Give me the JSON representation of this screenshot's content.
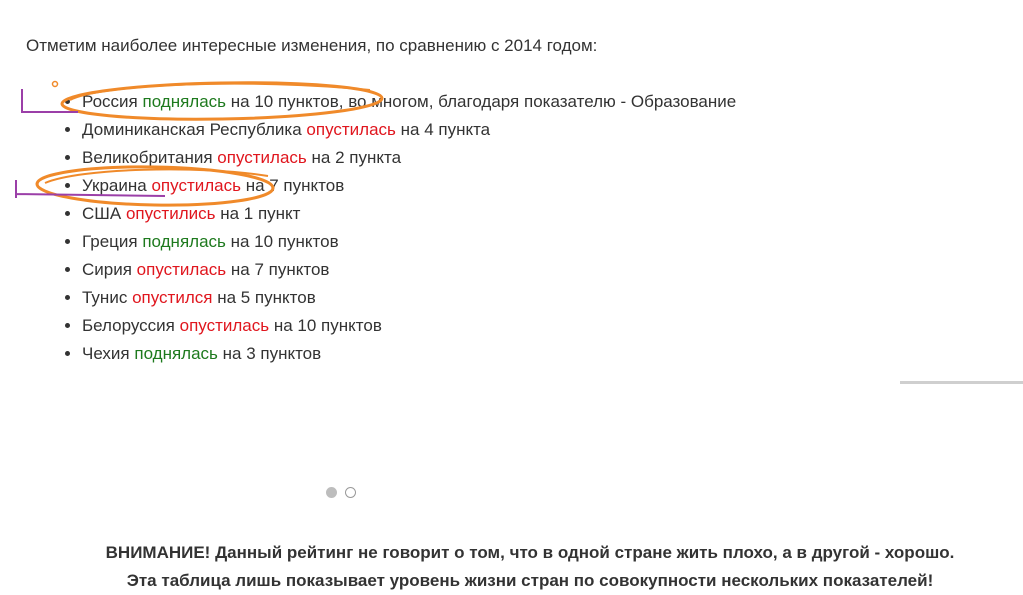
{
  "intro": "Отметим наиболее интересные изменения, по сравнению с 2014 годом:",
  "changes": [
    {
      "country": "Россия",
      "verb": "поднялась",
      "direction": "up",
      "rest": "на 10 пунктов, во многом, благодаря показателю - Образование"
    },
    {
      "country": "Доминиканская Республика",
      "verb": "опустилась",
      "direction": "down",
      "rest": "на 4 пункта"
    },
    {
      "country": "Великобритания",
      "verb": "опустилась",
      "direction": "down",
      "rest": "на 2 пункта"
    },
    {
      "country": "Украина",
      "verb": "опустилась",
      "direction": "down",
      "rest": "на 7 пунктов"
    },
    {
      "country": "США",
      "verb": "опустились",
      "direction": "down",
      "rest": "на 1 пункт"
    },
    {
      "country": "Греция",
      "verb": "поднялась",
      "direction": "up",
      "rest": "на 10 пунктов"
    },
    {
      "country": "Сирия",
      "verb": "опустилась",
      "direction": "down",
      "rest": "на 7 пунктов"
    },
    {
      "country": "Тунис",
      "verb": "опустился",
      "direction": "down",
      "rest": "на 5 пунктов"
    },
    {
      "country": "Белоруссия",
      "verb": "опустилась",
      "direction": "down",
      "rest": "на 10 пунктов"
    },
    {
      "country": "Чехия",
      "verb": "поднялась",
      "direction": "up",
      "rest": "на 3 пунктов"
    }
  ],
  "carousel": {
    "active_index": 0,
    "dot_count": 2
  },
  "warning": {
    "line1": "ВНИМАНИЕ! Данный рейтинг не говорит о том, что в одной стране жить плохо, а в другой - хорошо.",
    "line2": "Эта таблица лишь показывает уровень жизни стран по совокупности нескольких показателей!"
  },
  "colors": {
    "up": "#1e7a1e",
    "down": "#e0161e",
    "annotation_orange": "#f08a2a",
    "annotation_purple": "#9b3fa8"
  }
}
